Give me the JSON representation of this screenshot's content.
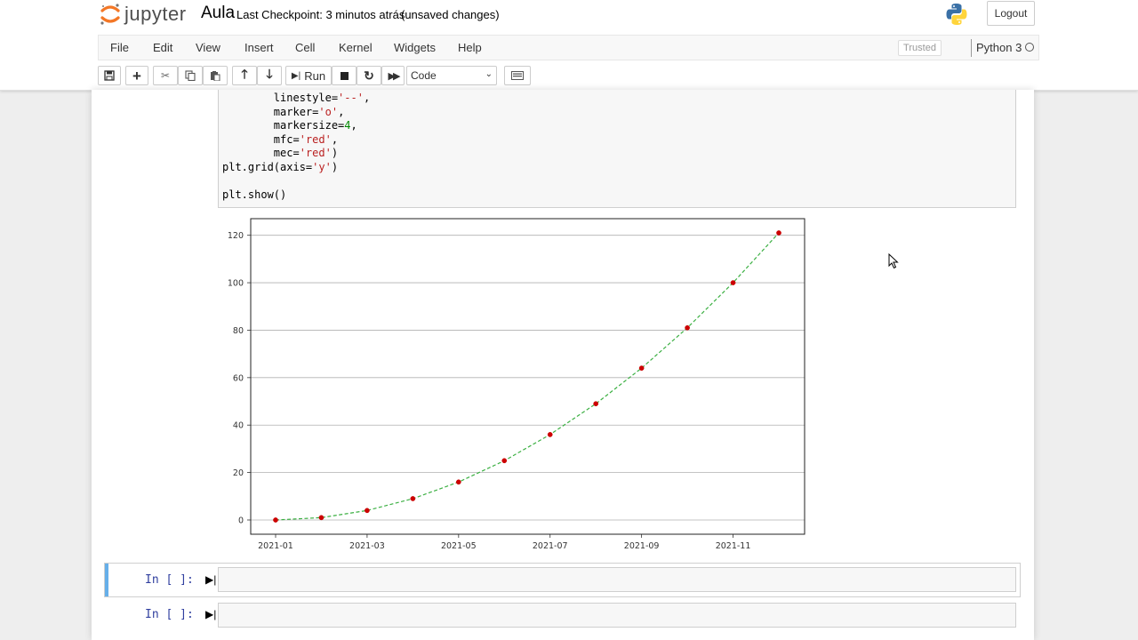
{
  "header": {
    "logo_text": "jupyter",
    "notebook_title": "Aula",
    "checkpoint": "Last Checkpoint: 3 minutos atrás",
    "status": "(unsaved changes)",
    "logout": "Logout"
  },
  "menu": {
    "items": [
      "File",
      "Edit",
      "View",
      "Insert",
      "Cell",
      "Kernel",
      "Widgets",
      "Help"
    ],
    "trusted": "Trusted",
    "kernel": "Python 3"
  },
  "toolbar": {
    "run_label": "Run",
    "cell_type": "Code"
  },
  "code": {
    "lines": [
      "        linestyle='--',",
      "        marker='o',",
      "        markersize=4,",
      "        mfc='red',",
      "        mec='red')",
      "plt.grid(axis='y')",
      "",
      "plt.show()"
    ]
  },
  "cells": [
    {
      "prompt": "In [ ]:"
    },
    {
      "prompt": "In [ ]:"
    }
  ],
  "colors": {
    "line": "#3cb043",
    "marker": "#cc0000",
    "prompt": "#303f9f",
    "selected_bar": "#66afe9"
  },
  "chart_data": {
    "type": "line",
    "x": [
      "2021-01",
      "2021-02",
      "2021-03",
      "2021-04",
      "2021-05",
      "2021-06",
      "2021-07",
      "2021-08",
      "2021-09",
      "2021-10",
      "2021-11",
      "2021-12"
    ],
    "y": [
      0,
      1,
      4,
      9,
      16,
      25,
      36,
      49,
      64,
      81,
      100,
      121
    ],
    "ylim": [
      -6,
      127
    ],
    "yticks": [
      0,
      20,
      40,
      60,
      80,
      100,
      120
    ],
    "xtick_labels": [
      "2021-01",
      "2021-03",
      "2021-05",
      "2021-07",
      "2021-09",
      "2021-11"
    ],
    "grid": "y",
    "linestyle": "--",
    "marker": "o",
    "title": "",
    "xlabel": "",
    "ylabel": ""
  }
}
